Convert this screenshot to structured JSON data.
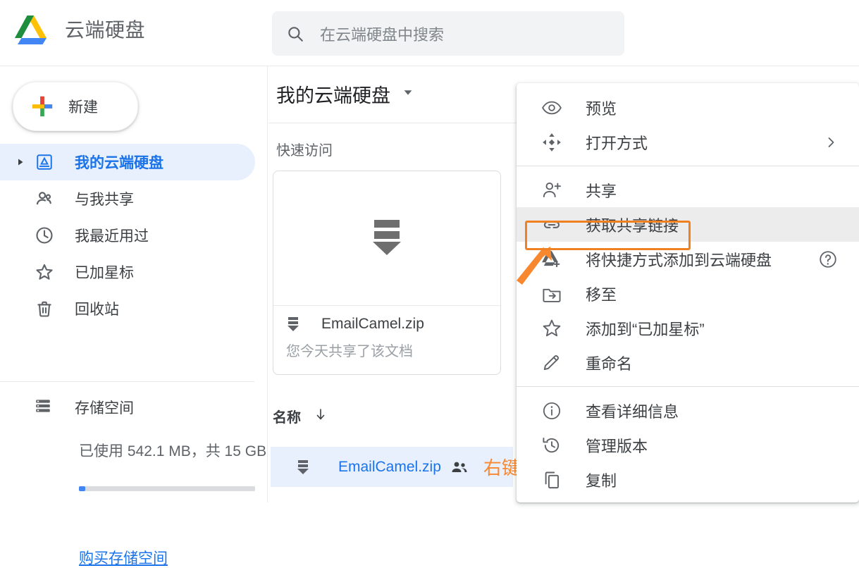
{
  "app": {
    "brand_title": "云端硬盘",
    "logo_icon": "google-drive-logo"
  },
  "search": {
    "icon": "search-icon",
    "placeholder": "在云端硬盘中搜索",
    "value": ""
  },
  "sidebar": {
    "new_button": {
      "label": "新建",
      "icon": "plus-icon"
    },
    "items": [
      {
        "label": "我的云端硬盘",
        "icon": "drive-outline-icon",
        "active": true,
        "expandable": true
      },
      {
        "label": "与我共享",
        "icon": "people-icon",
        "active": false,
        "expandable": false
      },
      {
        "label": "我最近用过",
        "icon": "clock-icon",
        "active": false,
        "expandable": false
      },
      {
        "label": "已加星标",
        "icon": "star-outline-icon",
        "active": false,
        "expandable": false
      },
      {
        "label": "回收站",
        "icon": "trash-icon",
        "active": false,
        "expandable": false
      }
    ],
    "storage": {
      "label": "存储空间",
      "icon": "storage-icon",
      "usage_text": "已使用 542.1 MB，共 15 GB",
      "used": "542.1 MB",
      "total": "15 GB",
      "percent": 3.5,
      "fill_color": "#4285f4",
      "buy_link": "购买存储空间"
    }
  },
  "main": {
    "title": "我的云端硬盘",
    "title_caret": "chevron-down-icon",
    "quick_access_label": "快速访问",
    "card": {
      "thumb_icon": "zip-archive-icon",
      "file_name": "EmailCamel.zip",
      "file_icon": "zip-file-icon",
      "subtitle": "您今天共享了该文档"
    },
    "list": {
      "column_name": "名称",
      "sort_icon": "arrow-down-icon",
      "rows": [
        {
          "name": "EmailCamel.zip",
          "icon": "zip-file-icon",
          "shared_icon": "people-filled-icon",
          "selected": true,
          "annotation": "右键"
        }
      ]
    }
  },
  "context_menu": {
    "groups": [
      {
        "items": [
          {
            "label": "预览",
            "icon": "eye-icon",
            "tail": "",
            "highlighted": false
          },
          {
            "label": "打开方式",
            "icon": "open-with-icon",
            "tail": "chevron-right-icon",
            "highlighted": false
          }
        ]
      },
      {
        "items": [
          {
            "label": "共享",
            "icon": "person-add-icon",
            "tail": "",
            "highlighted": false
          },
          {
            "label": "获取共享链接",
            "icon": "link-icon",
            "tail": "",
            "highlighted": true
          },
          {
            "label": "将快捷方式添加到云端硬盘",
            "icon": "drive-add-icon",
            "tail": "help-icon",
            "highlighted": false
          },
          {
            "label": "移至",
            "icon": "move-to-folder-icon",
            "tail": "",
            "highlighted": false
          },
          {
            "label": "添加到“已加星标”",
            "icon": "star-outline-icon",
            "tail": "",
            "highlighted": false
          },
          {
            "label": "重命名",
            "icon": "pencil-icon",
            "tail": "",
            "highlighted": false
          }
        ]
      },
      {
        "items": [
          {
            "label": "查看详细信息",
            "icon": "info-icon",
            "tail": "",
            "highlighted": false
          },
          {
            "label": "管理版本",
            "icon": "history-icon",
            "tail": "",
            "highlighted": false
          },
          {
            "label": "复制",
            "icon": "copy-icon",
            "tail": "",
            "highlighted": false
          }
        ]
      }
    ]
  },
  "colors": {
    "accent_blue": "#1a73e8",
    "selection_bg": "#e8f0fe",
    "annotation_orange": "#f08122",
    "menu_highlight_bg": "#ececec"
  }
}
